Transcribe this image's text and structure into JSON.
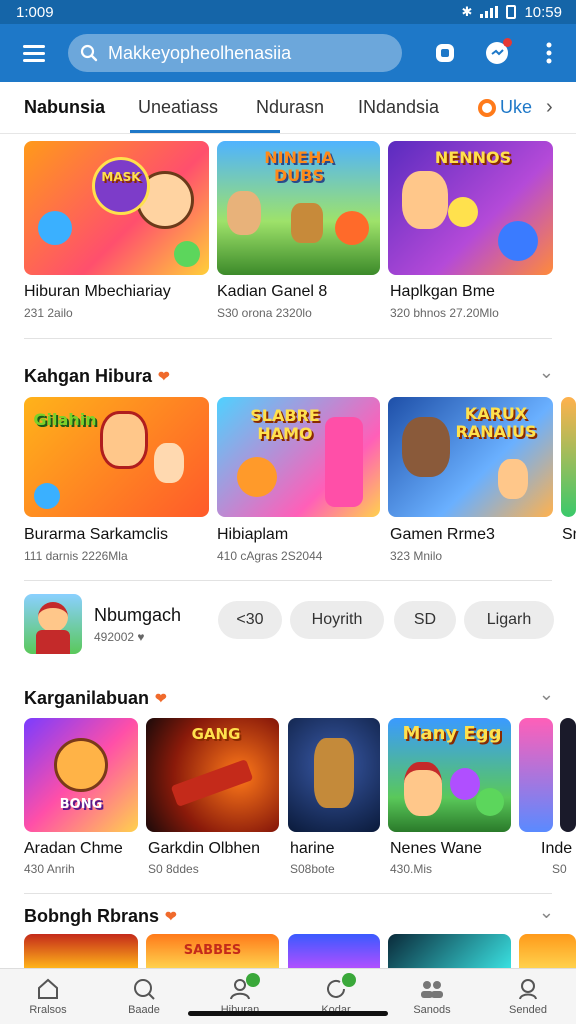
{
  "status_bar": {
    "time": "1:009",
    "clock_right": "10:59"
  },
  "search": {
    "text": "Makkeyopheolhenasiia"
  },
  "tabs": [
    {
      "label": "Nabunsia",
      "active": true
    },
    {
      "label": "Uneatiass"
    },
    {
      "label": "Ndurasn"
    },
    {
      "label": "INdandsia"
    },
    {
      "label": "Uke"
    }
  ],
  "top_row": [
    {
      "thumb_text": "MASK",
      "name": "Hiburan Mbechiariay",
      "meta": "231 2ailo"
    },
    {
      "thumb_text": "NINEHA DUBS",
      "name": "Kadian Ganel 8",
      "meta": "S30 orona 2320lo"
    },
    {
      "thumb_text": "NENNOS",
      "name": "Haplkgan Bme",
      "meta": "320 bhnos 27.20Mlo"
    }
  ],
  "section1": {
    "title": "Kahgan Hibura"
  },
  "row1": [
    {
      "thumb_text": "Gilahin",
      "name": "Burarma Sarkamclis",
      "meta": "111 darnis 2226Mla"
    },
    {
      "thumb_text": "SLABRE HAMO",
      "name": "Hibiaplam",
      "meta": "410 cAgras 2S2044"
    },
    {
      "thumb_text": "KARUX RANAIUS",
      "name": "Gamen Rrme3",
      "meta": "323 Mnilo"
    },
    {
      "thumb_text": "",
      "name": "Sr",
      "meta": ""
    }
  ],
  "featured": {
    "name": "Nbumgach",
    "meta": "492002",
    "chips": [
      "<30",
      "Hoyrith",
      "SD",
      "Ligarh"
    ]
  },
  "section2": {
    "title": "Karganilabuan"
  },
  "row2": [
    {
      "thumb_text": "BONG",
      "name": "Aradan Chme",
      "meta": "430 Anrih"
    },
    {
      "thumb_text": "GANG",
      "name": "Garkdin Olbhen",
      "meta": "S0 8ddes"
    },
    {
      "thumb_text": "",
      "name": "harine",
      "meta": "S08bote"
    },
    {
      "thumb_text": "Many Egg",
      "name": "Nenes Wane",
      "meta": "430.Mis"
    },
    {
      "thumb_text": "",
      "name": "Inde",
      "meta": "S0"
    }
  ],
  "section3": {
    "title": "Bobngh Rbrans"
  },
  "row3": [
    {
      "thumb_text": ""
    },
    {
      "thumb_text": "SABBES"
    },
    {
      "thumb_text": ""
    },
    {
      "thumb_text": ""
    },
    {
      "thumb_text": ""
    }
  ],
  "bottom_nav": [
    {
      "label": "Rralsos",
      "icon": "home-icon"
    },
    {
      "label": "Baade",
      "icon": "search-icon"
    },
    {
      "label": "Hiburan",
      "icon": "person-icon"
    },
    {
      "label": "Kodar",
      "icon": "refresh-icon"
    },
    {
      "label": "Sanods",
      "icon": "group-icon"
    },
    {
      "label": "Sended",
      "icon": "profile-icon"
    }
  ],
  "colors": {
    "accent": "#1e78c8",
    "status_bar": "#1565a8",
    "heart": "#f06a2c"
  }
}
